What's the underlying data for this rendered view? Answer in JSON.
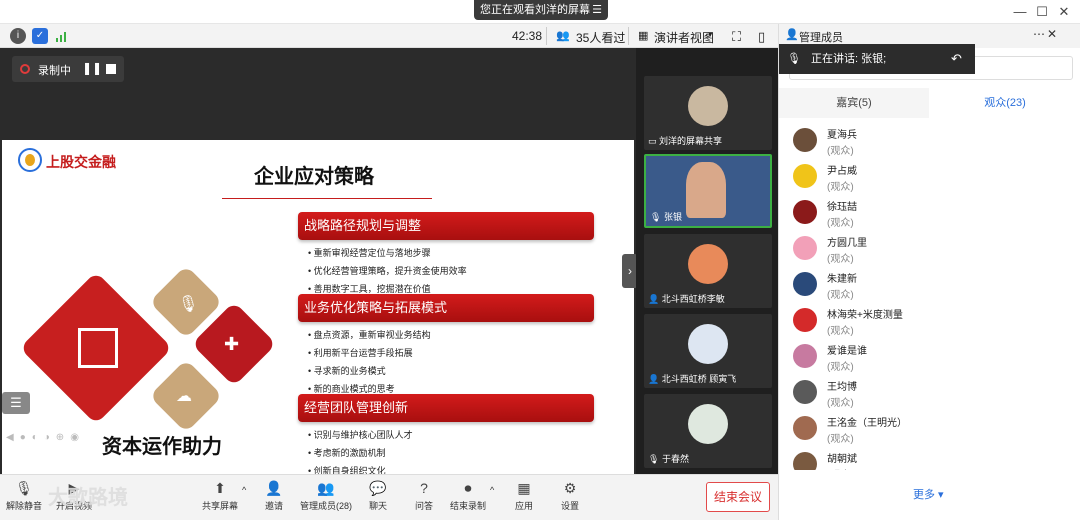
{
  "banner": {
    "text": "您正在观看刘洋的屏幕"
  },
  "toolbar": {
    "timer": "42:38",
    "viewers": "35人看过",
    "view_mode": "演讲者视图"
  },
  "recording": {
    "label": "录制中"
  },
  "slide": {
    "logo_text": "上股交金融",
    "title": "企业应对策略",
    "left_caption": "资本运作助力",
    "sections": [
      {
        "title": "战略路径规划与调整",
        "bullets": [
          "重新审视经营定位与落地步骤",
          "优化经营管理策略，提升资金使用效率",
          "善用数字工具，挖掘潜在价值"
        ]
      },
      {
        "title": "业务优化策略与拓展模式",
        "bullets": [
          "盘点资源，重新审视业务结构",
          "利用新平台运营手段拓展",
          "寻求新的业务模式",
          "新的商业模式的思考"
        ]
      },
      {
        "title": "经营团队管理创新",
        "bullets": [
          "识别与维护核心团队人才",
          "考虑新的激励机制",
          "创新自身组织文化"
        ]
      }
    ]
  },
  "videos": [
    {
      "name": "刘洋的屏幕共享"
    },
    {
      "name": "张银"
    },
    {
      "name": "北斗西虹桥李敏"
    },
    {
      "name": "北斗西虹桥 顾寅飞"
    },
    {
      "name": "于春然"
    }
  ],
  "panel": {
    "title": "管理成员",
    "speaking": "正在讲话: 张银;",
    "tab_guests": "嘉宾(5)",
    "tab_audience": "观众(23)",
    "more": "更多",
    "members": [
      {
        "name": "夏海兵",
        "role": "(观众)",
        "color": "#6b4f3a"
      },
      {
        "name": "尹占威",
        "role": "(观众)",
        "color": "#f0c419"
      },
      {
        "name": "徐珏喆",
        "role": "(观众)",
        "color": "#8b1a1a"
      },
      {
        "name": "方圆几里",
        "role": "(观众)",
        "color": "#f2a0b8"
      },
      {
        "name": "朱建新",
        "role": "(观众)",
        "color": "#2a4a7a"
      },
      {
        "name": "林海荣+米度测量",
        "role": "(观众)",
        "color": "#d42a2a"
      },
      {
        "name": "爱谁是谁",
        "role": "(观众)",
        "color": "#c77aa0"
      },
      {
        "name": "王均博",
        "role": "(观众)",
        "color": "#5a5a5a"
      },
      {
        "name": "王洺金（王明光）",
        "role": "(观众)",
        "color": "#a06a50"
      },
      {
        "name": "胡朝斌",
        "role": "(观众)",
        "color": "#7a5a40"
      }
    ]
  },
  "bottom": {
    "share_screen": "共享屏幕",
    "invite": "邀请",
    "manage_members": "管理成员(28)",
    "chat": "聊天",
    "qa": "问答",
    "end_record": "结束录制",
    "apps": "应用",
    "settings": "设置",
    "end_meeting": "结束会议",
    "mute": "解除静音",
    "video": "开启视频",
    "watermark": "大歌路境"
  }
}
